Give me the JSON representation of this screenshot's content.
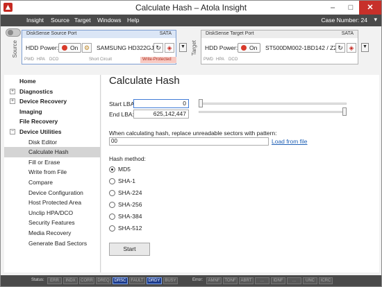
{
  "window": {
    "title": "Calculate Hash – Atola Insight",
    "minimize_glyph": "–",
    "maximize_glyph": "□",
    "close_glyph": "✕"
  },
  "menu": {
    "items": [
      "Insight",
      "Source",
      "Target",
      "Windows",
      "Help"
    ],
    "case_number": "Case Number: 24",
    "case_chevron": "▾"
  },
  "source_port": {
    "side_label": "Source",
    "title": "DiskSense Source Port",
    "interface": "SATA",
    "hdd_power_label": "HDD Power:",
    "power_state": "On",
    "drive_name": "SAMSUNG HD322GJ...",
    "status_tags": [
      "PWD",
      "HPA",
      "DCO"
    ],
    "short_circuit": "Short Circuit",
    "write_protected": "Write-Protected"
  },
  "target_port": {
    "side_label": "Target",
    "title": "DiskSense Target Port",
    "interface": "SATA",
    "hdd_power_label": "HDD Power:",
    "power_state": "On",
    "drive_name": "ST500DM002-1BD142 / Z2...",
    "status_tags": [
      "PWD",
      "HPA",
      "DCO"
    ]
  },
  "sidebar": {
    "items": [
      {
        "label": "Home",
        "level": 0,
        "bold": true
      },
      {
        "label": "Diagnostics",
        "level": 0,
        "bold": true,
        "expander": "+"
      },
      {
        "label": "Device Recovery",
        "level": 0,
        "bold": true,
        "expander": "+"
      },
      {
        "label": "Imaging",
        "level": 0,
        "bold": true
      },
      {
        "label": "File Recovery",
        "level": 0,
        "bold": true
      },
      {
        "label": "Device Utilities",
        "level": 0,
        "bold": true,
        "expander": "−"
      },
      {
        "label": "Disk Editor",
        "level": 1
      },
      {
        "label": "Calculate Hash",
        "level": 1,
        "selected": true
      },
      {
        "label": "Fill or Erase",
        "level": 1
      },
      {
        "label": "Write from File",
        "level": 1
      },
      {
        "label": "Compare",
        "level": 1
      },
      {
        "label": "Device Configuration",
        "level": 1
      },
      {
        "label": "Host Protected Area",
        "level": 1
      },
      {
        "label": "Unclip HPA/DCO",
        "level": 1
      },
      {
        "label": "Security Features",
        "level": 1
      },
      {
        "label": "Media Recovery",
        "level": 1
      },
      {
        "label": "Generate Bad Sectors",
        "level": 1
      }
    ]
  },
  "main": {
    "title": "Calculate Hash",
    "start_lba_label": "Start LBA:",
    "start_lba_value": "0",
    "end_lba_label": "End LBA:",
    "end_lba_value": "625,142,447",
    "start_slider_fraction": 0.0,
    "end_slider_fraction": 1.0,
    "pattern_label": "When calculating hash, replace unreadable sectors with pattern:",
    "pattern_value": "00",
    "load_from_file": "Load from file",
    "hash_method_label": "Hash method:",
    "hash_methods": [
      "MD5",
      "SHA-1",
      "SHA-224",
      "SHA-256",
      "SHA-384",
      "SHA-512"
    ],
    "selected_method": "MD5",
    "start_button": "Start"
  },
  "statusbar": {
    "status_label": "Status:",
    "status_flags": [
      {
        "name": "ERR",
        "on": false
      },
      {
        "name": "INDX",
        "on": false
      },
      {
        "name": "CORR",
        "on": false
      },
      {
        "name": "DREQ",
        "on": false
      },
      {
        "name": "DRSC",
        "on": true
      },
      {
        "name": "FAULT",
        "on": false
      },
      {
        "name": "DRDY",
        "on": true
      },
      {
        "name": "BUSY",
        "on": false
      }
    ],
    "error_label": "Error:",
    "error_flags": [
      "AMNF",
      "TONF",
      "ABRT",
      "...",
      "IDNF",
      "...",
      "UNC",
      "ICRC"
    ]
  },
  "colors": {
    "titlebar_bg": "#ffffff",
    "menubar_bg": "#4a4a4a",
    "close_button": "#c7302a",
    "port_border": "#7c9dd1",
    "selected_nav": "#d4d4d4",
    "link": "#1e5fb5",
    "power_on": "#d83a2a",
    "status_on": "#1d3c8c"
  }
}
